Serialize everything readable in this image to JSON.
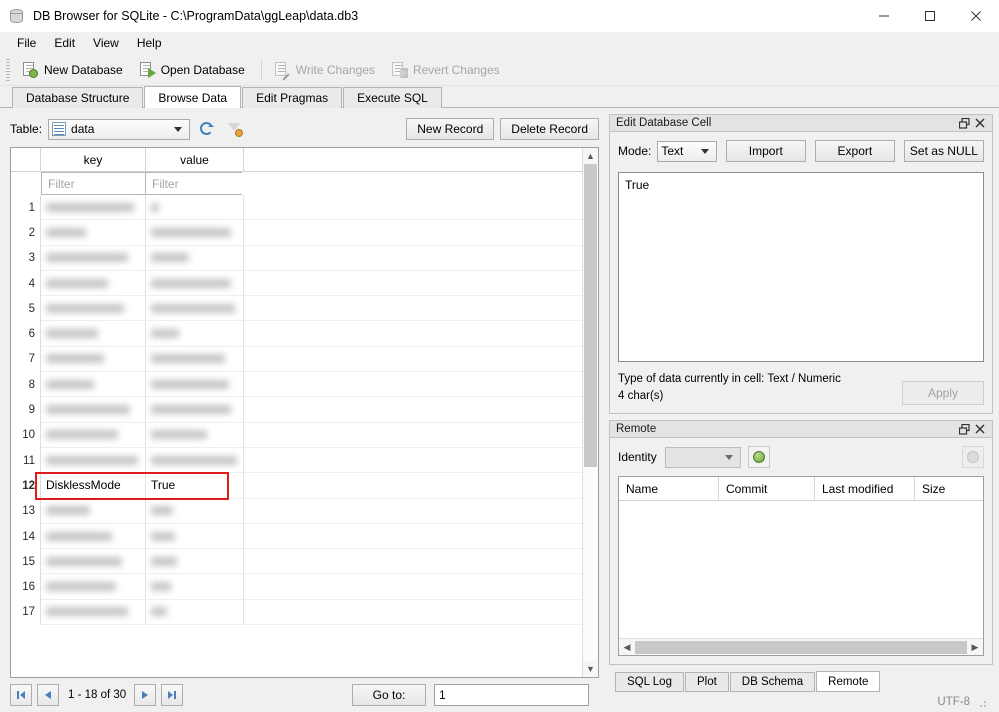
{
  "window": {
    "title": "DB Browser for SQLite - C:\\ProgramData\\ggLeap\\data.db3",
    "icon": "database-icon",
    "minimize": "–",
    "maximize": "□",
    "close": "✕"
  },
  "menubar": {
    "items": [
      "File",
      "Edit",
      "View",
      "Help"
    ]
  },
  "toolbar": {
    "buttons": [
      {
        "label": "New Database",
        "icon": "new-database-icon",
        "enabled": true
      },
      {
        "label": "Open Database",
        "icon": "open-database-icon",
        "enabled": true
      },
      {
        "label": "Write Changes",
        "icon": "write-changes-icon",
        "enabled": false
      },
      {
        "label": "Revert Changes",
        "icon": "revert-changes-icon",
        "enabled": false
      }
    ]
  },
  "tabs": {
    "items": [
      "Database Structure",
      "Browse Data",
      "Edit Pragmas",
      "Execute SQL"
    ],
    "active": "Browse Data"
  },
  "browse": {
    "table_label": "Table:",
    "table_value": "data",
    "refresh_icon": "refresh-icon",
    "clear_filter_icon": "clear-filter-icon",
    "new_record": "New Record",
    "delete_record": "Delete Record",
    "columns": [
      "key",
      "value"
    ],
    "filter_placeholder": "Filter",
    "rows": [
      {
        "n": "1",
        "key": "",
        "value": "",
        "redacted": true,
        "w1": 88,
        "w2": 8
      },
      {
        "n": "2",
        "key": "",
        "value": "",
        "redacted": true,
        "w1": 40,
        "w2": 80
      },
      {
        "n": "3",
        "key": "",
        "value": "",
        "redacted": true,
        "w1": 82,
        "w2": 38
      },
      {
        "n": "4",
        "key": "",
        "value": "",
        "redacted": true,
        "w1": 62,
        "w2": 80
      },
      {
        "n": "5",
        "key": "",
        "value": "",
        "redacted": true,
        "w1": 78,
        "w2": 84
      },
      {
        "n": "6",
        "key": "",
        "value": "",
        "redacted": true,
        "w1": 52,
        "w2": 28
      },
      {
        "n": "7",
        "key": "",
        "value": "",
        "redacted": true,
        "w1": 58,
        "w2": 74
      },
      {
        "n": "8",
        "key": "",
        "value": "",
        "redacted": true,
        "w1": 48,
        "w2": 78
      },
      {
        "n": "9",
        "key": "",
        "value": "",
        "redacted": true,
        "w1": 84,
        "w2": 80
      },
      {
        "n": "10",
        "key": "",
        "value": "",
        "redacted": true,
        "w1": 72,
        "w2": 56
      },
      {
        "n": "11",
        "key": "",
        "value": "",
        "redacted": true,
        "w1": 92,
        "w2": 86
      },
      {
        "n": "12",
        "key": "DisklessMode",
        "value": "True",
        "redacted": false,
        "selected": true
      },
      {
        "n": "13",
        "key": "",
        "value": "",
        "redacted": true,
        "w1": 44,
        "w2": 22
      },
      {
        "n": "14",
        "key": "",
        "value": "",
        "redacted": true,
        "w1": 66,
        "w2": 24
      },
      {
        "n": "15",
        "key": "",
        "value": "",
        "redacted": true,
        "w1": 76,
        "w2": 26
      },
      {
        "n": "16",
        "key": "",
        "value": "",
        "redacted": true,
        "w1": 70,
        "w2": 20
      },
      {
        "n": "17",
        "key": "",
        "value": "",
        "redacted": true,
        "w1": 82,
        "w2": 16
      }
    ],
    "highlight_color": "#e01b1b"
  },
  "pager": {
    "first_icon": "first-page-icon",
    "prev_icon": "previous-page-icon",
    "range_text": "1 - 18 of 30",
    "next_icon": "next-page-icon",
    "last_icon": "last-page-icon",
    "goto_label": "Go to:",
    "goto_value": "1"
  },
  "edit_cell": {
    "panel_title": "Edit Database Cell",
    "float_icon": "float-panel-icon",
    "close_icon": "close-panel-icon",
    "mode_label": "Mode:",
    "mode_value": "Text",
    "import_label": "Import",
    "export_label": "Export",
    "set_null_label": "Set as NULL",
    "content": "True",
    "type_line": "Type of data currently in cell: Text / Numeric",
    "char_line": "4 char(s)",
    "apply_label": "Apply"
  },
  "remote": {
    "panel_title": "Remote",
    "float_icon": "float-panel-icon",
    "close_icon": "close-panel-icon",
    "identity_label": "Identity",
    "identity_value": "",
    "add_identity_icon": "add-identity-icon",
    "clone_icon": "clone-icon",
    "columns": [
      "Name",
      "Commit",
      "Last modified",
      "Size"
    ],
    "rows": []
  },
  "bottom_tabs": {
    "items": [
      "SQL Log",
      "Plot",
      "DB Schema",
      "Remote"
    ],
    "active": "Remote"
  },
  "statusbar": {
    "encoding": "UTF-8"
  }
}
